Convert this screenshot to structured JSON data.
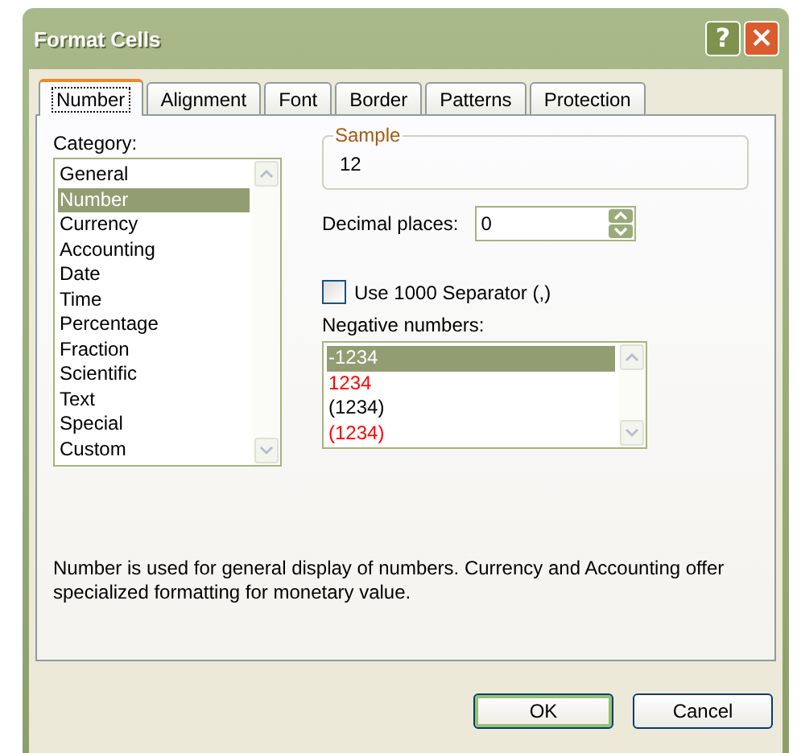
{
  "window": {
    "title": "Format Cells",
    "buttons": [
      {
        "kind": "help",
        "label": "?"
      },
      {
        "kind": "close",
        "label": "×"
      }
    ]
  },
  "tabs": [
    {
      "label": "Number",
      "selected": true
    },
    {
      "label": "Alignment",
      "selected": false
    },
    {
      "label": "Font",
      "selected": false
    },
    {
      "label": "Border",
      "selected": false
    },
    {
      "label": "Patterns",
      "selected": false
    },
    {
      "label": "Protection",
      "selected": false
    }
  ],
  "category": {
    "label": "Category:",
    "items": [
      {
        "label": "General",
        "selected": false
      },
      {
        "label": "Number",
        "selected": true
      },
      {
        "label": "Currency",
        "selected": false
      },
      {
        "label": "Accounting",
        "selected": false
      },
      {
        "label": "Date",
        "selected": false
      },
      {
        "label": "Time",
        "selected": false
      },
      {
        "label": "Percentage",
        "selected": false
      },
      {
        "label": "Fraction",
        "selected": false
      },
      {
        "label": "Scientific",
        "selected": false
      },
      {
        "label": "Text",
        "selected": false
      },
      {
        "label": "Special",
        "selected": false
      },
      {
        "label": "Custom",
        "selected": false
      }
    ]
  },
  "sample": {
    "label": "Sample",
    "value": "12"
  },
  "decimal_places": {
    "label": "Decimal places:",
    "value": "0"
  },
  "separator": {
    "label": "Use 1000 Separator (,)",
    "checked": false
  },
  "negative_numbers": {
    "label": "Negative numbers:",
    "items": [
      {
        "label": "-1234",
        "selected": true
      },
      {
        "label": "1234",
        "selected": false,
        "color": "#ff0000"
      },
      {
        "label": "(1234)",
        "selected": false,
        "color": "#000000"
      },
      {
        "label": "(1234)",
        "selected": false,
        "color": "#ff0000"
      }
    ]
  },
  "description": "Number is used for general display of numbers.  Currency and Accounting offer specialized formatting for monetary value.",
  "buttons": [
    {
      "label": "OK",
      "default": true
    },
    {
      "label": "Cancel",
      "default": false
    }
  ]
}
